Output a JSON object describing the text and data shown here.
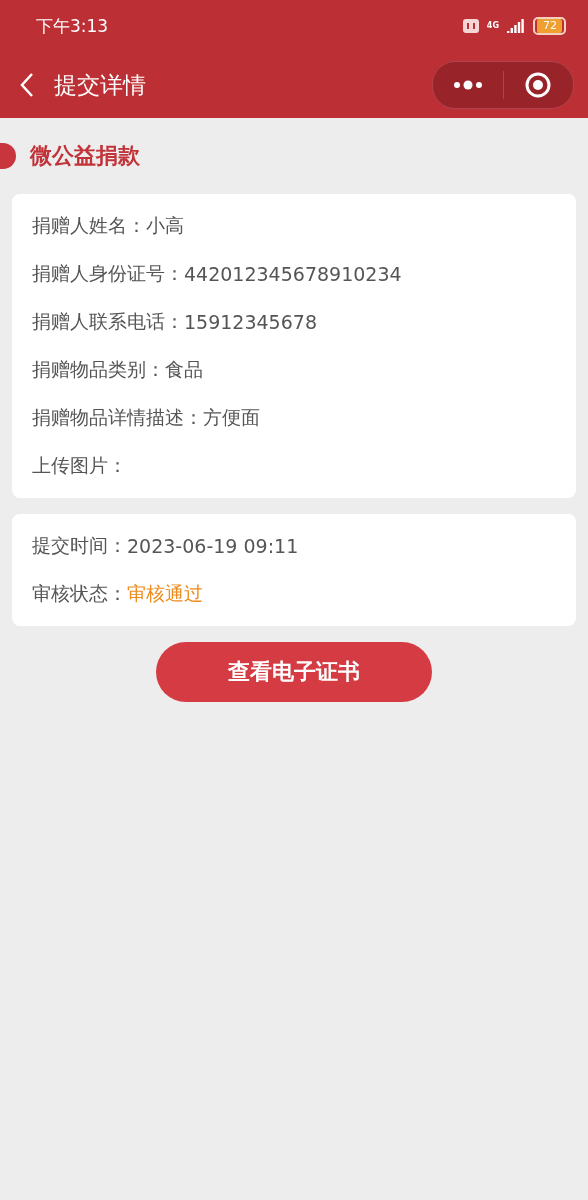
{
  "status_bar": {
    "time": "下午3:13",
    "network": "4G",
    "battery": "72"
  },
  "nav": {
    "title": "提交详情"
  },
  "section_title": "微公益捐款",
  "details": [
    {
      "label": "捐赠人姓名：",
      "value": "小高"
    },
    {
      "label": "捐赠人身份证号：",
      "value": "442012345678910234"
    },
    {
      "label": "捐赠人联系电话：",
      "value": "15912345678"
    },
    {
      "label": "捐赠物品类别：",
      "value": "食品"
    },
    {
      "label": "捐赠物品详情描述：",
      "value": "方便面"
    },
    {
      "label": "上传图片："
    }
  ],
  "submission": [
    {
      "kind": "text",
      "label": "提交时间：",
      "value": "2023-06-19 09:11"
    },
    {
      "kind": "status",
      "label": "审核状态：",
      "value": "审核通过"
    }
  ],
  "button": "查看电子证书"
}
